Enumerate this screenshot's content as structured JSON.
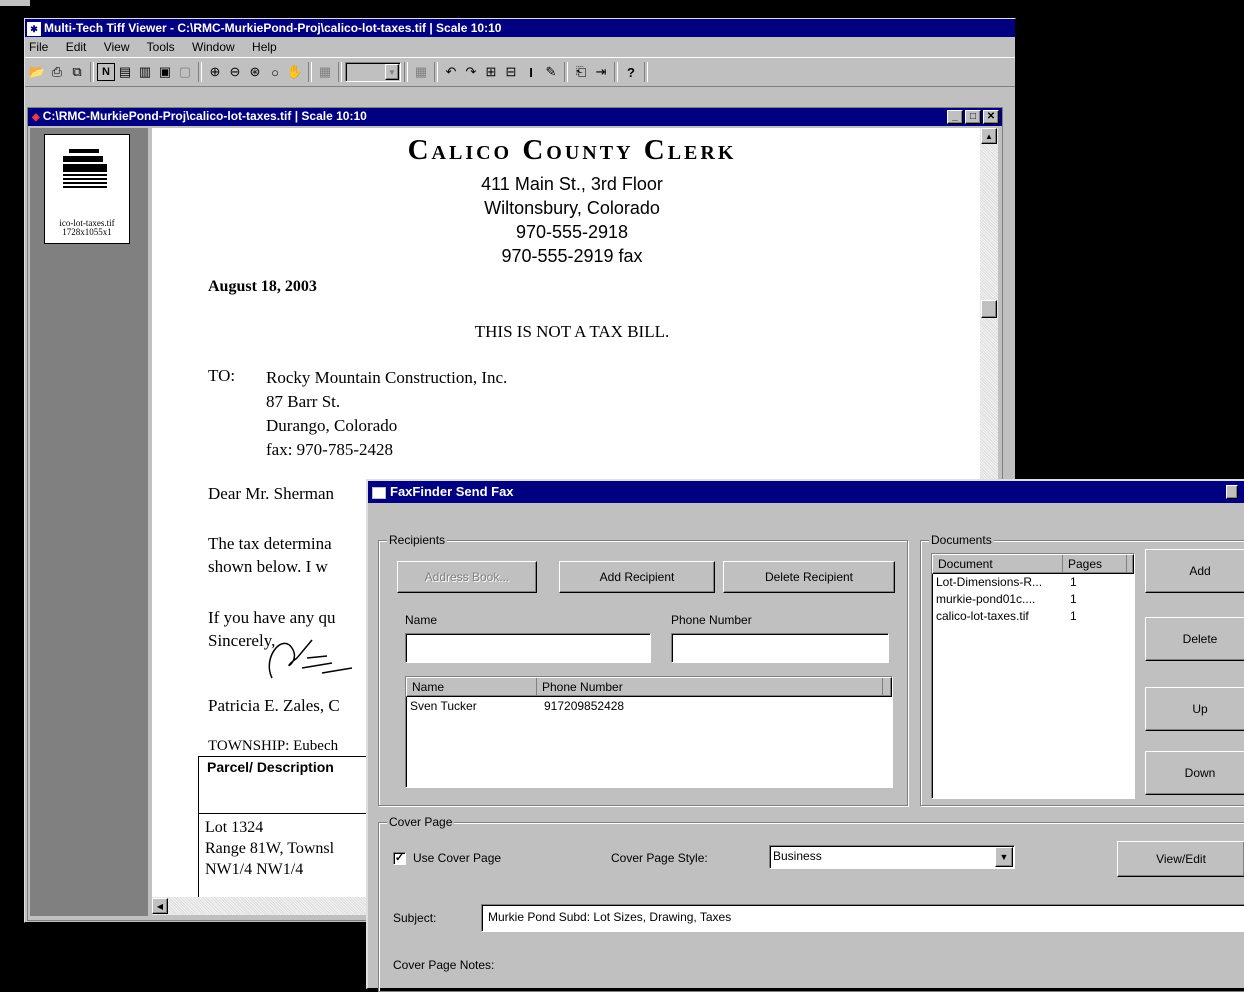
{
  "main_window": {
    "title": "Multi-Tech Tiff Viewer - C:\\RMC-MurkiePond-Proj\\calico-lot-taxes.tif | Scale 10:10",
    "menu": [
      "File",
      "Edit",
      "View",
      "Tools",
      "Window",
      "Help"
    ],
    "toolbar_icons": [
      "open-icon",
      "print-icon",
      "copy-icon",
      "n-icon",
      "page-view-icon",
      "two-page-icon",
      "fit-icon",
      "fit-width-icon",
      "zoom-in-icon",
      "zoom-out-icon",
      "zoom-all-icon",
      "zoom-custom-icon",
      "hand-icon",
      "disabled-doc-icon",
      "page-select",
      "disabled-doc-icon",
      "rotate-left-icon",
      "rotate-right-icon",
      "expand-icon",
      "collapse-icon",
      "text-cursor-icon",
      "annotate-icon",
      "export-icon",
      "exit-icon",
      "help-icon"
    ]
  },
  "child_window": {
    "title": "C:\\RMC-MurkiePond-Proj\\calico-lot-taxes.tif | Scale 10:10",
    "thumbnail": {
      "name": "ico-lot-taxes.tif",
      "size": "1728x1055x1"
    }
  },
  "document": {
    "heading": "Calico County Clerk",
    "address_lines": [
      "411 Main St., 3rd Floor",
      "Wiltonsbury, Colorado",
      "970-555-2918",
      "970-555-2919 fax"
    ],
    "date": "August 18, 2003",
    "notice": "THIS IS NOT A TAX BILL.",
    "to_label": "TO:",
    "to_lines": [
      "Rocky Mountain Construction, Inc.",
      "87 Barr St.",
      "Durango, Colorado",
      "fax: 970-785-2428"
    ],
    "salutation": "Dear Mr. Sherman",
    "body1a": "The tax determina",
    "body1b": "shown below.  I w",
    "body2a": "If you have any qu",
    "body2b": "Sincerely,",
    "signer": "Patricia E. Zales, C",
    "township": "TOWNSHIP:  Eubech",
    "table_header": "Parcel/ Description",
    "lot_lines": [
      "Lot 1324",
      "Range 81W, Townsl",
      "NW1/4 NW1/4"
    ]
  },
  "fax_dialog": {
    "title": "FaxFinder Send Fax",
    "recipients_label": "Recipients",
    "address_book": "Address Book...",
    "add_recipient": "Add Recipient",
    "delete_recipient": "Delete Recipient",
    "name_label": "Name",
    "phone_label": "Phone Number",
    "name_value": "",
    "phone_value": "",
    "list_headers": [
      "Name",
      "Phone Number"
    ],
    "recipients": [
      {
        "name": "Sven Tucker",
        "phone": "917209852428"
      }
    ],
    "documents_label": "Documents",
    "doc_headers": [
      "Document",
      "Pages"
    ],
    "documents": [
      {
        "name": "Lot-Dimensions-R...",
        "pages": "1"
      },
      {
        "name": "murkie-pond01c....",
        "pages": "1"
      },
      {
        "name": "calico-lot-taxes.tif",
        "pages": "1"
      }
    ],
    "doc_buttons": {
      "add": "Add",
      "delete": "Delete",
      "up": "Up",
      "down": "Down"
    },
    "cover_label": "Cover Page",
    "use_cover": "Use Cover Page",
    "use_cover_checked": "✓",
    "style_label": "Cover Page Style:",
    "style_value": "Business",
    "view_edit": "View/Edit",
    "subject_label": "Subject:",
    "subject_value": "Murkie Pond Subd: Lot Sizes, Drawing, Taxes",
    "notes_label": "Cover Page Notes:"
  }
}
